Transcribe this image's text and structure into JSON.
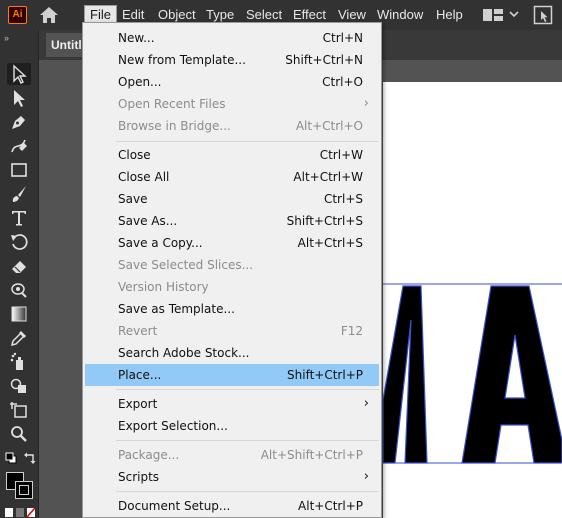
{
  "app": {
    "logo_text": "Ai",
    "accent": "#ff7c00"
  },
  "menubar": {
    "items": [
      "File",
      "Edit",
      "Object",
      "Type",
      "Select",
      "Effect",
      "View",
      "Window",
      "Help"
    ],
    "active": "File"
  },
  "document": {
    "tab_title": "Untitle"
  },
  "file_menu": {
    "items": [
      {
        "label": "New...",
        "shortcut": "Ctrl+N",
        "disabled": false
      },
      {
        "label": "New from Template...",
        "shortcut": "Shift+Ctrl+N",
        "disabled": false
      },
      {
        "label": "Open...",
        "shortcut": "Ctrl+O",
        "disabled": false
      },
      {
        "label": "Open Recent Files",
        "shortcut": "",
        "disabled": true,
        "submenu": true
      },
      {
        "label": "Browse in Bridge...",
        "shortcut": "Alt+Ctrl+O",
        "disabled": true
      },
      {
        "label": "Close",
        "shortcut": "Ctrl+W",
        "disabled": false
      },
      {
        "label": "Close All",
        "shortcut": "Alt+Ctrl+W",
        "disabled": false
      },
      {
        "label": "Save",
        "shortcut": "Ctrl+S",
        "disabled": false
      },
      {
        "label": "Save As...",
        "shortcut": "Shift+Ctrl+S",
        "disabled": false
      },
      {
        "label": "Save a Copy...",
        "shortcut": "Alt+Ctrl+S",
        "disabled": false
      },
      {
        "label": "Save Selected Slices...",
        "shortcut": "",
        "disabled": true
      },
      {
        "label": "Version History",
        "shortcut": "",
        "disabled": true
      },
      {
        "label": "Save as Template...",
        "shortcut": "",
        "disabled": false
      },
      {
        "label": "Revert",
        "shortcut": "F12",
        "disabled": true
      },
      {
        "label": "Search Adobe Stock...",
        "shortcut": "",
        "disabled": false
      },
      {
        "label": "Place...",
        "shortcut": "Shift+Ctrl+P",
        "disabled": false,
        "highlighted": true
      },
      {
        "label": "Export",
        "shortcut": "",
        "disabled": false,
        "submenu": true
      },
      {
        "label": "Export Selection...",
        "shortcut": "",
        "disabled": false
      },
      {
        "label": "Package...",
        "shortcut": "Alt+Shift+Ctrl+P",
        "disabled": true
      },
      {
        "label": "Scripts",
        "shortcut": "",
        "disabled": false,
        "submenu": true
      },
      {
        "label": "Document Setup...",
        "shortcut": "Alt+Ctrl+P",
        "disabled": false
      }
    ],
    "submenu_glyph": "›",
    "highlight_color": "#91c9f7"
  },
  "toolbar": {
    "collapse_glyph": "»",
    "tools": [
      "selection-tool",
      "direct-selection-tool",
      "pen-tool",
      "curvature-tool",
      "rectangle-tool",
      "paintbrush-tool",
      "type-tool",
      "rotate-tool",
      "eraser-tool",
      "warp-tool",
      "gradient-tool",
      "eyedropper-tool",
      "symbol-sprayer-tool",
      "shape-builder-tool",
      "artboard-tool",
      "zoom-tool"
    ]
  }
}
